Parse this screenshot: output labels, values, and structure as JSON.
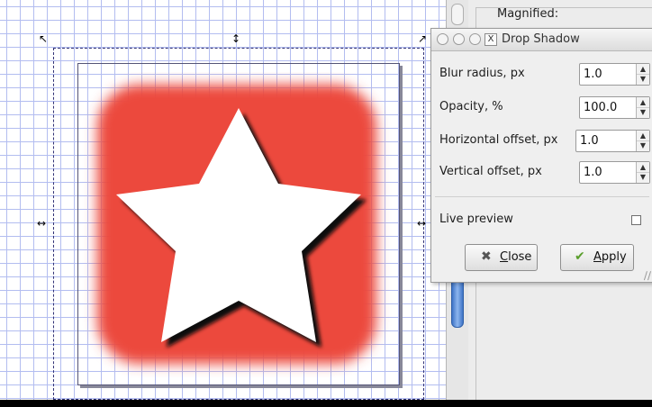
{
  "dock": {
    "section_label": "Magnified:"
  },
  "dialog": {
    "title": "Drop Shadow",
    "fields": [
      {
        "label": "Blur radius, px",
        "value": "1.0"
      },
      {
        "label": "Opacity, %",
        "value": "100.0"
      },
      {
        "label": "Horizontal offset, px",
        "value": "1.0"
      },
      {
        "label": "Vertical offset, px",
        "value": "1.0"
      }
    ],
    "live_preview": {
      "label": "Live preview",
      "checked": false
    },
    "close_button": {
      "mnemonic": "C",
      "rest": "lose"
    },
    "apply_button": {
      "mnemonic": "A",
      "rest": "pply"
    }
  },
  "icons": {
    "handles": [
      "arrow-nw-icon",
      "arrow-ns-icon",
      "arrow-ne-icon",
      "arrow-ew-icon"
    ],
    "close": "x-cross-icon",
    "apply": "checkmark-icon",
    "window_close": "x-box-icon"
  },
  "colors": {
    "square_fill": "#ec4a3e",
    "star_fill": "#ffffff",
    "scroll_thumb": "#5b8dd9",
    "grid": "#b3bdf0"
  }
}
